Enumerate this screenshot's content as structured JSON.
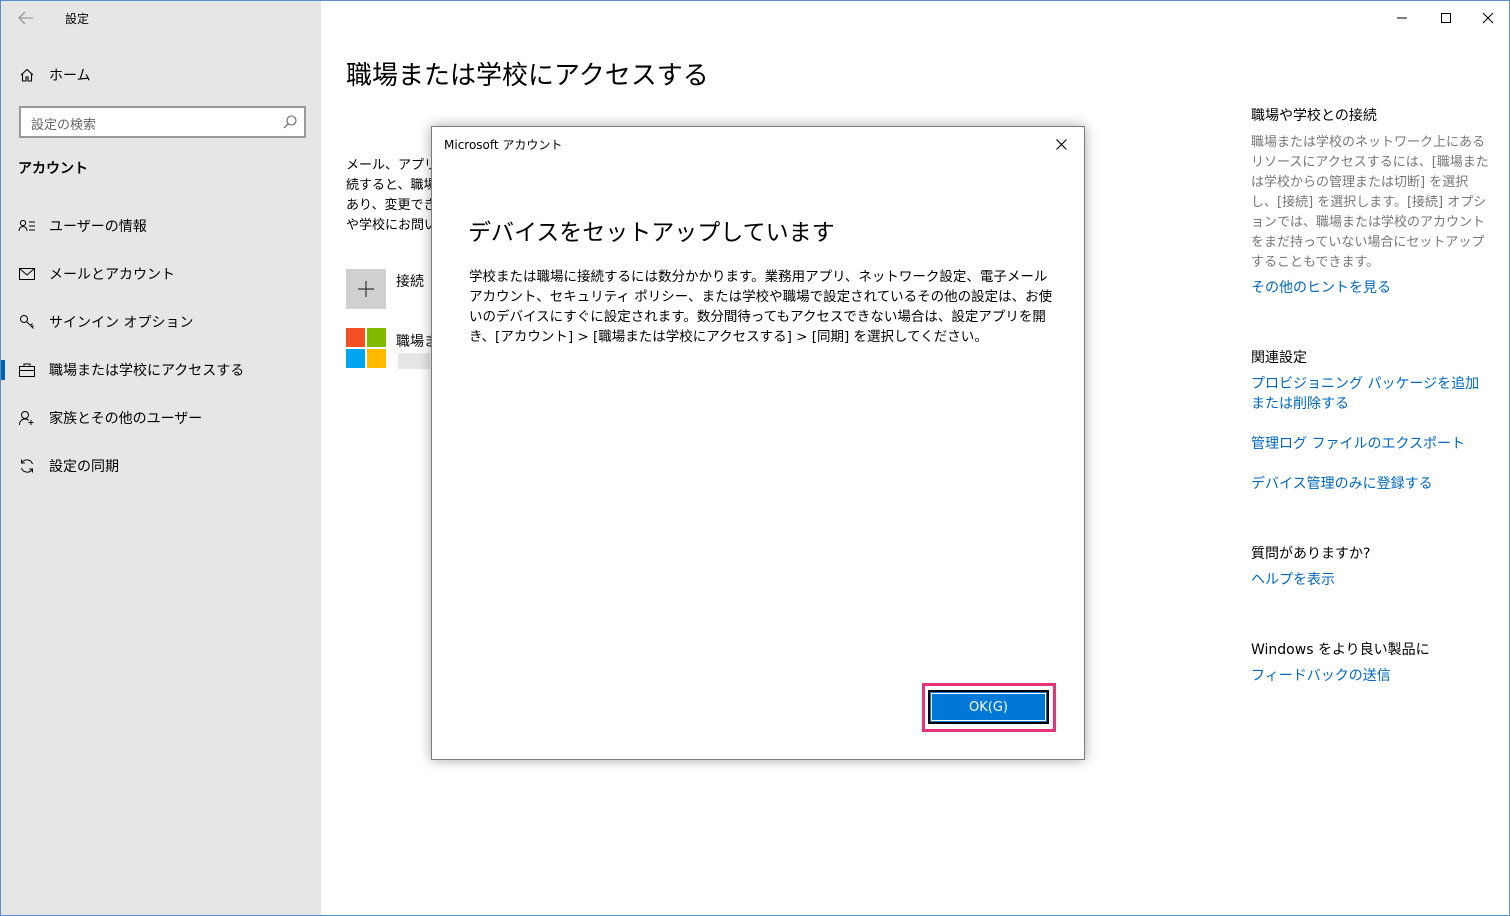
{
  "window": {
    "app_title": "設定"
  },
  "sidebar": {
    "home_label": "ホーム",
    "search_placeholder": "設定の検索",
    "section_title": "アカウント",
    "items": [
      {
        "label": "ユーザーの情報",
        "icon": "user-info-icon"
      },
      {
        "label": "メールとアカウント",
        "icon": "mail-icon"
      },
      {
        "label": "サインイン オプション",
        "icon": "key-icon"
      },
      {
        "label": "職場または学校にアクセスする",
        "icon": "briefcase-icon",
        "active": true
      },
      {
        "label": "家族とその他のユーザー",
        "icon": "add-user-icon"
      },
      {
        "label": "設定の同期",
        "icon": "sync-icon"
      }
    ]
  },
  "main": {
    "page_title": "職場または学校にアクセスする",
    "description_lines": [
      "メール、アプリ、",
      "続すると、職場",
      "あり、変更でき",
      "や学校にお問い"
    ],
    "connect_label": "接続",
    "account_label": "職場ま"
  },
  "right_panel": {
    "section1_title": "職場や学校との接続",
    "section1_text": "職場または学校のネットワーク上にあるリソースにアクセスするには、[職場または学校からの管理または切断] を選択し、[接続] を選択します。[接続] オプションでは、職場または学校のアカウントをまだ持っていない場合にセットアップすることもできます。",
    "section1_link": "その他のヒントを見る",
    "section2_title": "関連設定",
    "section2_links": [
      "プロビジョニング パッケージを追加または削除する",
      "管理ログ ファイルのエクスポート",
      "デバイス管理のみに登録する"
    ],
    "section3_title": "質問がありますか?",
    "section3_link": "ヘルプを表示",
    "section4_title": "Windows をより良い製品に",
    "section4_link": "フィードバックの送信"
  },
  "dialog": {
    "title": "Microsoft アカウント",
    "heading": "デバイスをセットアップしています",
    "body": "学校または職場に接続するには数分かかります。業務用アプリ、ネットワーク設定、電子メール アカウント、セキュリティ ポリシー、または学校や職場で設定されているその他の設定は、お使いのデバイスにすぐに設定されます。数分間待ってもアクセスできない場合は、設定アプリを開き、[アカウント] > [職場または学校にアクセスする] > [同期] を選択してください。",
    "ok_label": "OK(G)"
  },
  "colors": {
    "accent": "#0078d7",
    "link": "#0067c0",
    "highlight": "#e8337a",
    "sidebar_bg": "#e6e6e6"
  }
}
